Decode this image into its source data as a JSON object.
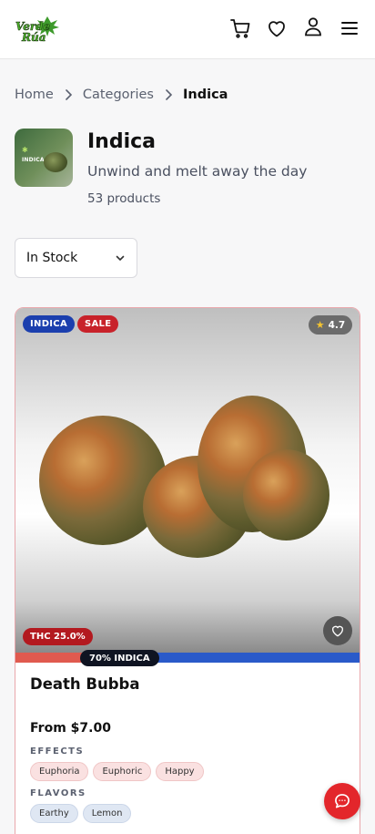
{
  "header": {
    "logo_text": "Verde Rúa",
    "icons": [
      "cart-icon",
      "heart-icon",
      "user-icon",
      "menu-icon"
    ]
  },
  "breadcrumb": {
    "items": [
      "Home",
      "Categories",
      "Indica"
    ]
  },
  "category": {
    "thumb_label": "INDICA",
    "title": "Indica",
    "subtitle": "Unwind and melt away the day",
    "count": "53 products"
  },
  "filter": {
    "selected": "In Stock"
  },
  "product": {
    "badges": [
      "INDICA",
      "SALE"
    ],
    "rating": "4.7",
    "thc": "THC 25.0%",
    "strain_label": "70% INDICA",
    "indica_fraction": 0.7,
    "name": "Death Bubba",
    "price": "From $7.00",
    "effects_title": "EFFECTS",
    "effects": [
      "Euphoria",
      "Euphoric",
      "Happy"
    ],
    "flavors_title": "FLAVORS",
    "flavors": [
      "Earthy",
      "Lemon"
    ]
  },
  "colors": {
    "accent_red": "#e3262b",
    "indica_blue": "#2a5ac9",
    "sale_red": "#c8222a",
    "indica_badge": "#1b3fae"
  }
}
